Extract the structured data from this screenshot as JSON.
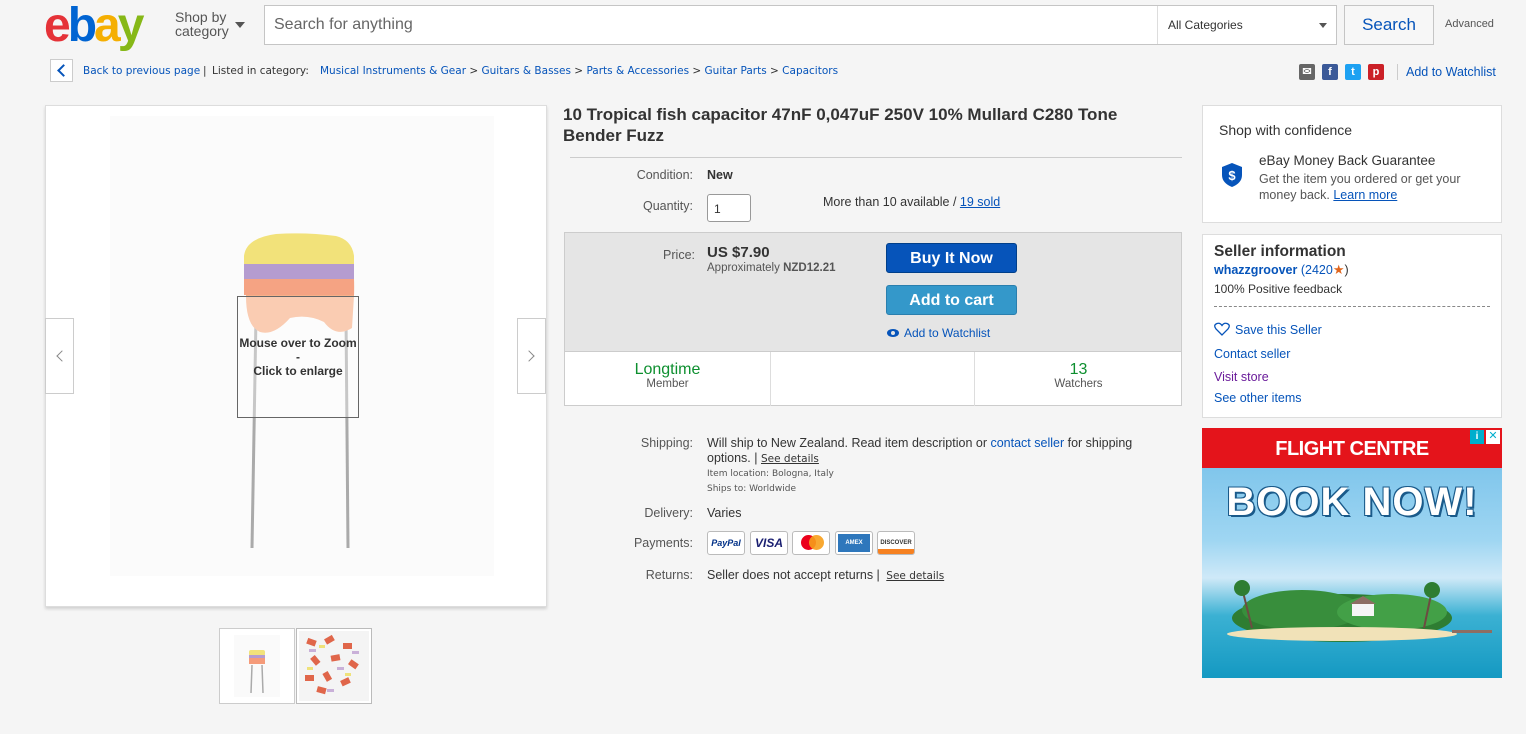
{
  "header": {
    "logo": {
      "e": "e",
      "b": "b",
      "a": "a",
      "y": "y"
    },
    "shop_by_line1": "Shop by",
    "shop_by_line2": "category",
    "search_placeholder": "Search for anything",
    "category_select": "All Categories",
    "search_button": "Search",
    "advanced": "Advanced"
  },
  "breadcrumb": {
    "back": "Back to previous page",
    "listed_in": "Listed in category:",
    "items": [
      "Musical Instruments & Gear",
      "Guitars & Basses",
      "Parts & Accessories",
      "Guitar Parts",
      "Capacitors"
    ],
    "sep": ">",
    "add_to_watchlist": "Add to Watchlist"
  },
  "share_icons": [
    "email-icon",
    "facebook-icon",
    "twitter-icon",
    "pinterest-icon"
  ],
  "gallery": {
    "zoom_line1": "Mouse over to Zoom",
    "zoom_line2": "-",
    "zoom_line3": "Click to enlarge"
  },
  "item": {
    "title": "10 Tropical fish capacitor 47nF 0,047uF 250V 10% Mullard C280 Tone Bender Fuzz",
    "condition_label": "Condition:",
    "condition": "New",
    "quantity_label": "Quantity:",
    "quantity": "1",
    "availability": "More than 10 available /",
    "sold": "19 sold",
    "price_label": "Price:",
    "price": "US $7.90",
    "approx_label": "Approximately",
    "approx_value": "NZD12.21",
    "buy_now": "Buy It Now",
    "add_to_cart": "Add to cart",
    "add_to_watchlist": "Add to Watchlist",
    "stats": [
      {
        "big": "Longtime",
        "small": "Member"
      },
      {
        "big": "",
        "small": ""
      },
      {
        "big": "13",
        "small": "Watchers"
      }
    ],
    "shipping_label": "Shipping:",
    "shipping_text1": "Will ship to New Zealand. Read item description or",
    "shipping_link": "contact seller",
    "shipping_text2": "for shipping",
    "shipping_text3": "options. |",
    "see_details": "See details",
    "item_location": "Item location:  Bologna, Italy",
    "ships_to": "Ships to:  Worldwide",
    "delivery_label": "Delivery:",
    "delivery": "Varies",
    "payments_label": "Payments:",
    "payments": [
      "PayPal",
      "VISA",
      "MC",
      "AMEX",
      "DISCOVER"
    ],
    "returns_label": "Returns:",
    "returns": "Seller does not accept returns |",
    "returns_details": "See details"
  },
  "confidence": {
    "title": "Shop with confidence",
    "guarantee": "eBay Money Back Guarantee",
    "desc1": "Get the item you ordered or get your",
    "desc2": "money back.",
    "learn_more": "Learn more"
  },
  "seller": {
    "title": "Seller information",
    "name": "whazzgroover",
    "feedback_count": "(2420",
    "feedback_close": ")",
    "positive": "100% Positive feedback",
    "save": "Save this Seller",
    "contact": "Contact seller",
    "visit": "Visit store",
    "other": "See other items"
  },
  "ad": {
    "brand": "FLIGHT CENTRE",
    "cta": "BOOK NOW!",
    "info": "i",
    "close": "✕"
  },
  "colors": {
    "ebay_blue": "#0654ba",
    "buy_now": "#0654ba",
    "add_cart": "#3498ca",
    "longtime_green": "#0d8f2f",
    "ad_red": "#e4141b"
  }
}
